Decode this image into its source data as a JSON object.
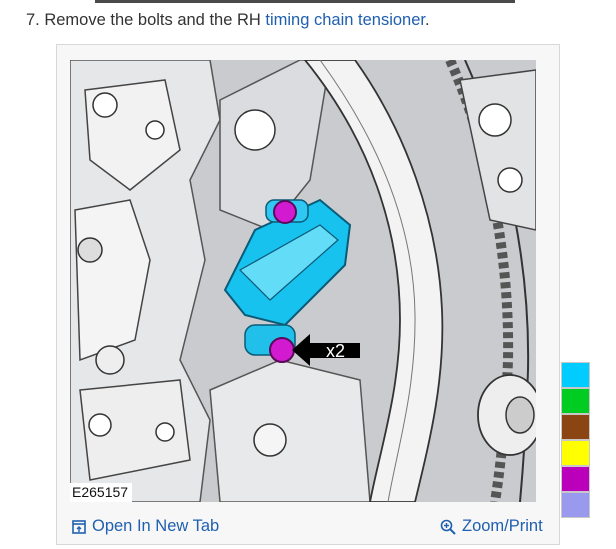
{
  "step": {
    "prefix": "7. Remove the bolts and the RH ",
    "link": "timing chain tensioner",
    "suffix": "."
  },
  "figure": {
    "id": "E265157",
    "callout": "x2"
  },
  "footer": {
    "open_tab": "Open In New Tab",
    "zoom": "Zoom/Print"
  },
  "swatches": [
    "#00ccff",
    "#00cc22",
    "#8b4513",
    "#ffff00",
    "#bb00bb",
    "#9999ee"
  ]
}
